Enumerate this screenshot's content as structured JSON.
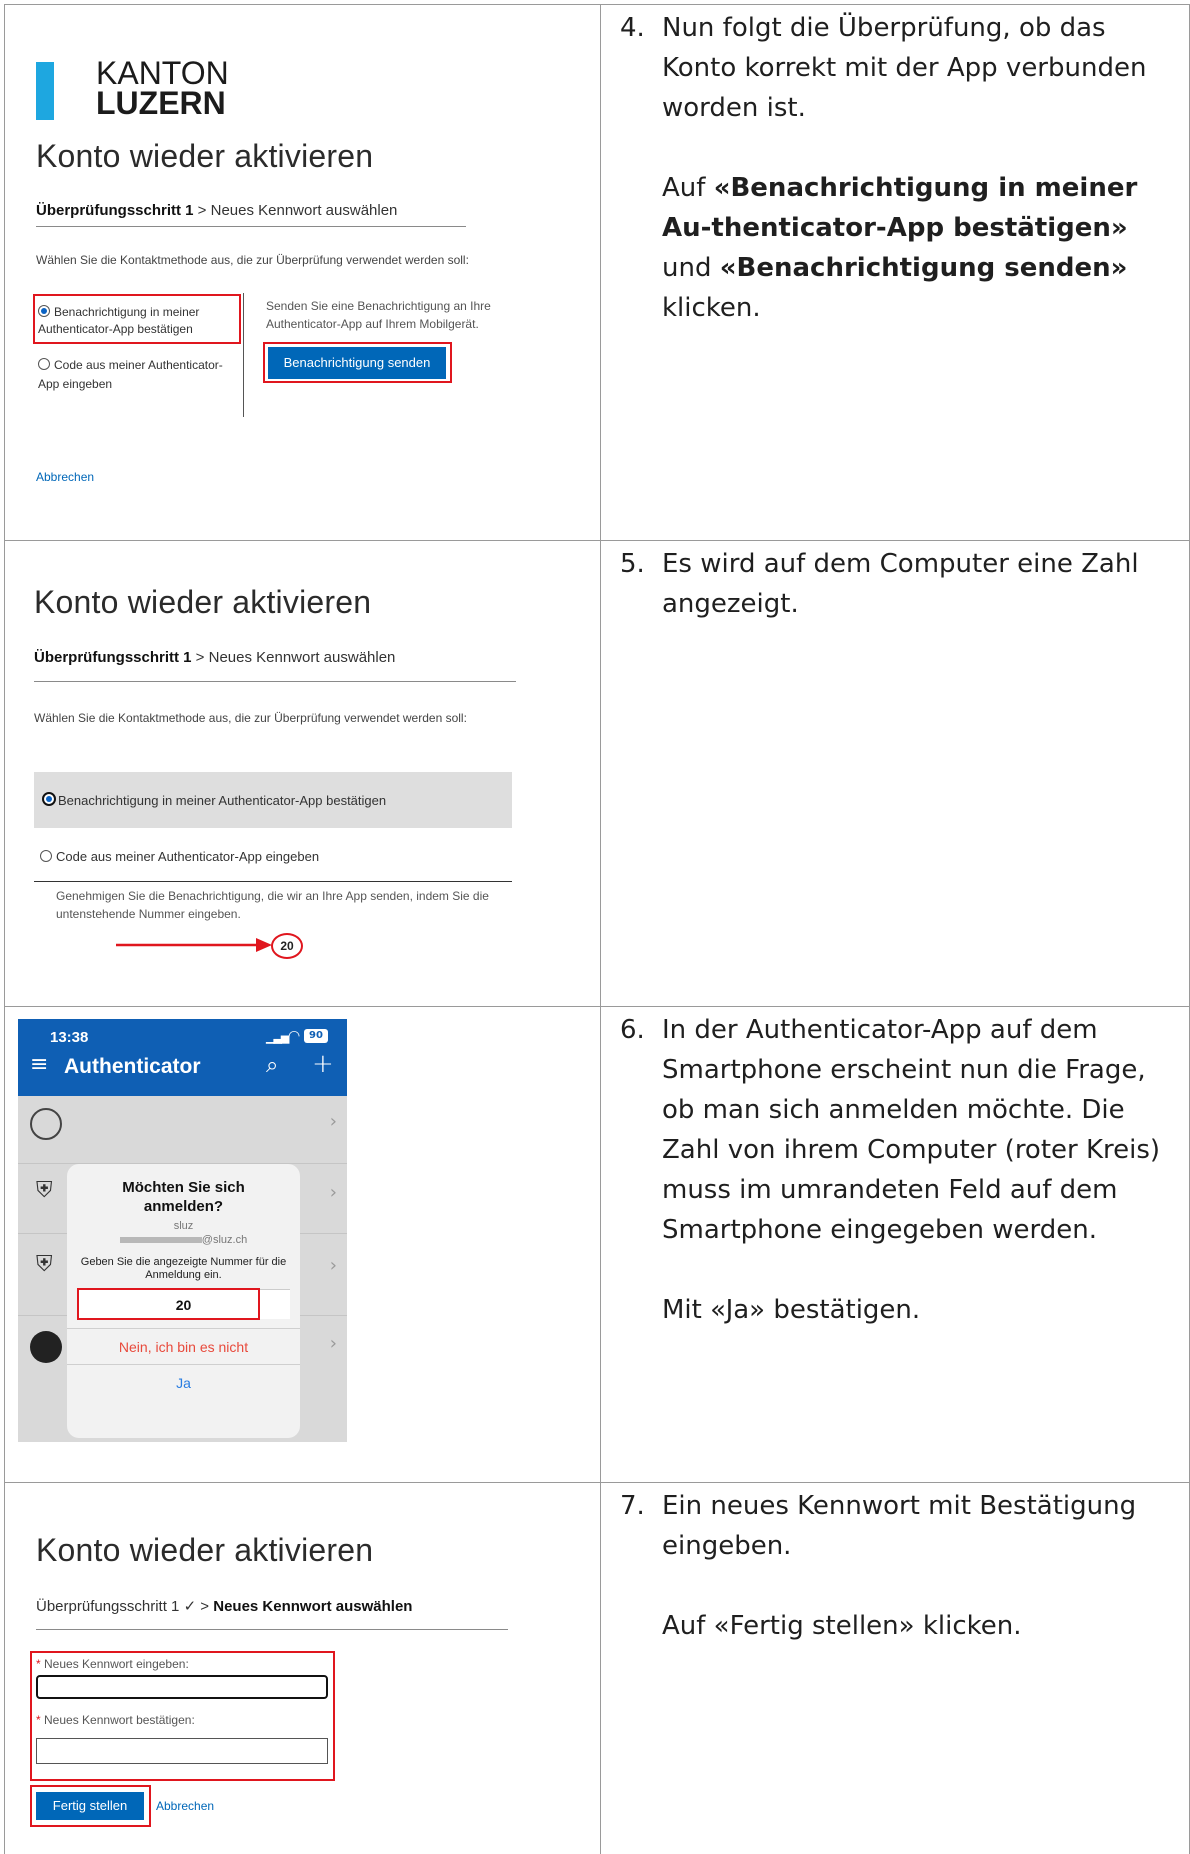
{
  "steps": [
    {
      "number": "4.",
      "line1": "Nun folgt die Überprüfung, ob das Konto korrekt mit der App verbunden worden ist.",
      "line2_prefix": "Auf ",
      "line2_bold1": "«Benachrichtigung in meiner Au-thenticator-App bestätigen»",
      "line2_mid": " und ",
      "line2_bold2": "«Benachrichtigung senden»",
      "line2_suffix": " klicken."
    },
    {
      "number": "5.",
      "line1": "Es wird auf dem Computer eine Zahl angezeigt."
    },
    {
      "number": "6.",
      "line1": "In der Authenticator-App auf dem Smartphone erscheint nun die Frage, ob man sich anmelden möchte. Die Zahl von ihrem Computer (roter Kreis) muss im umrandeten Feld auf dem Smartphone eingegeben werden.",
      "line2": "Mit «Ja» bestätigen."
    },
    {
      "number": "7.",
      "line1": "Ein neues Kennwort mit Bestätigung eingeben.",
      "line2": "Auf «Fertig stellen» klicken."
    }
  ],
  "panel1": {
    "logo_line1": "KANTON",
    "logo_line2": "LUZERN",
    "title": "Konto wieder aktivieren",
    "step_bold": "Überprüfungsschritt 1",
    "step_rest": " > Neues Kennwort auswählen",
    "instruction": "Wählen Sie die Kontaktmethode aus, die zur Überprüfung verwendet werden soll:",
    "option1": "Benachrichtigung in meiner Authenticator-App bestätigen",
    "option2": "Code aus meiner Authenticator-App eingeben",
    "send_text": "Senden Sie eine Benachrichtigung an Ihre Authenticator-App auf Ihrem Mobilgerät.",
    "send_button": "Benachrichtigung senden",
    "cancel": "Abbrechen"
  },
  "panel2": {
    "title": "Konto wieder aktivieren",
    "step_bold": "Überprüfungsschritt 1",
    "step_rest": " > Neues Kennwort auswählen",
    "instruction": "Wählen Sie die Kontaktmethode aus, die zur Überprüfung verwendet werden soll:",
    "option1": "Benachrichtigung in meiner Authenticator-App bestätigen",
    "option2": "Code aus meiner Authenticator-App eingeben",
    "approve_text": "Genehmigen Sie die Benachrichtigung, die wir an Ihre App senden, indem Sie die untenstehende Nummer eingeben.",
    "number": "20"
  },
  "phone": {
    "time": "13:38",
    "battery": "90",
    "app_title": "Authenticator",
    "dialog_title": "Möchten Sie sich anmelden?",
    "account": "sluz",
    "email_suffix": "@sluz.ch",
    "prompt": "Geben Sie die angezeigte Nummer für die Anmeldung ein.",
    "number": "20",
    "deny": "Nein, ich bin es nicht",
    "approve": "Ja"
  },
  "panel4": {
    "title": "Konto wieder aktivieren",
    "step_done": "Überprüfungsschritt 1 ✓ > ",
    "step_bold": "Neues Kennwort auswählen",
    "field1_label": "Neues Kennwort eingeben:",
    "field2_label": "Neues Kennwort bestätigen:",
    "finish_button": "Fertig stellen",
    "cancel": "Abbrechen"
  },
  "colors": {
    "accent_blue": "#0067b8",
    "highlight_red": "#e0161e",
    "logo_blue": "#1ea7e0",
    "phone_header": "#0f5fb4"
  }
}
